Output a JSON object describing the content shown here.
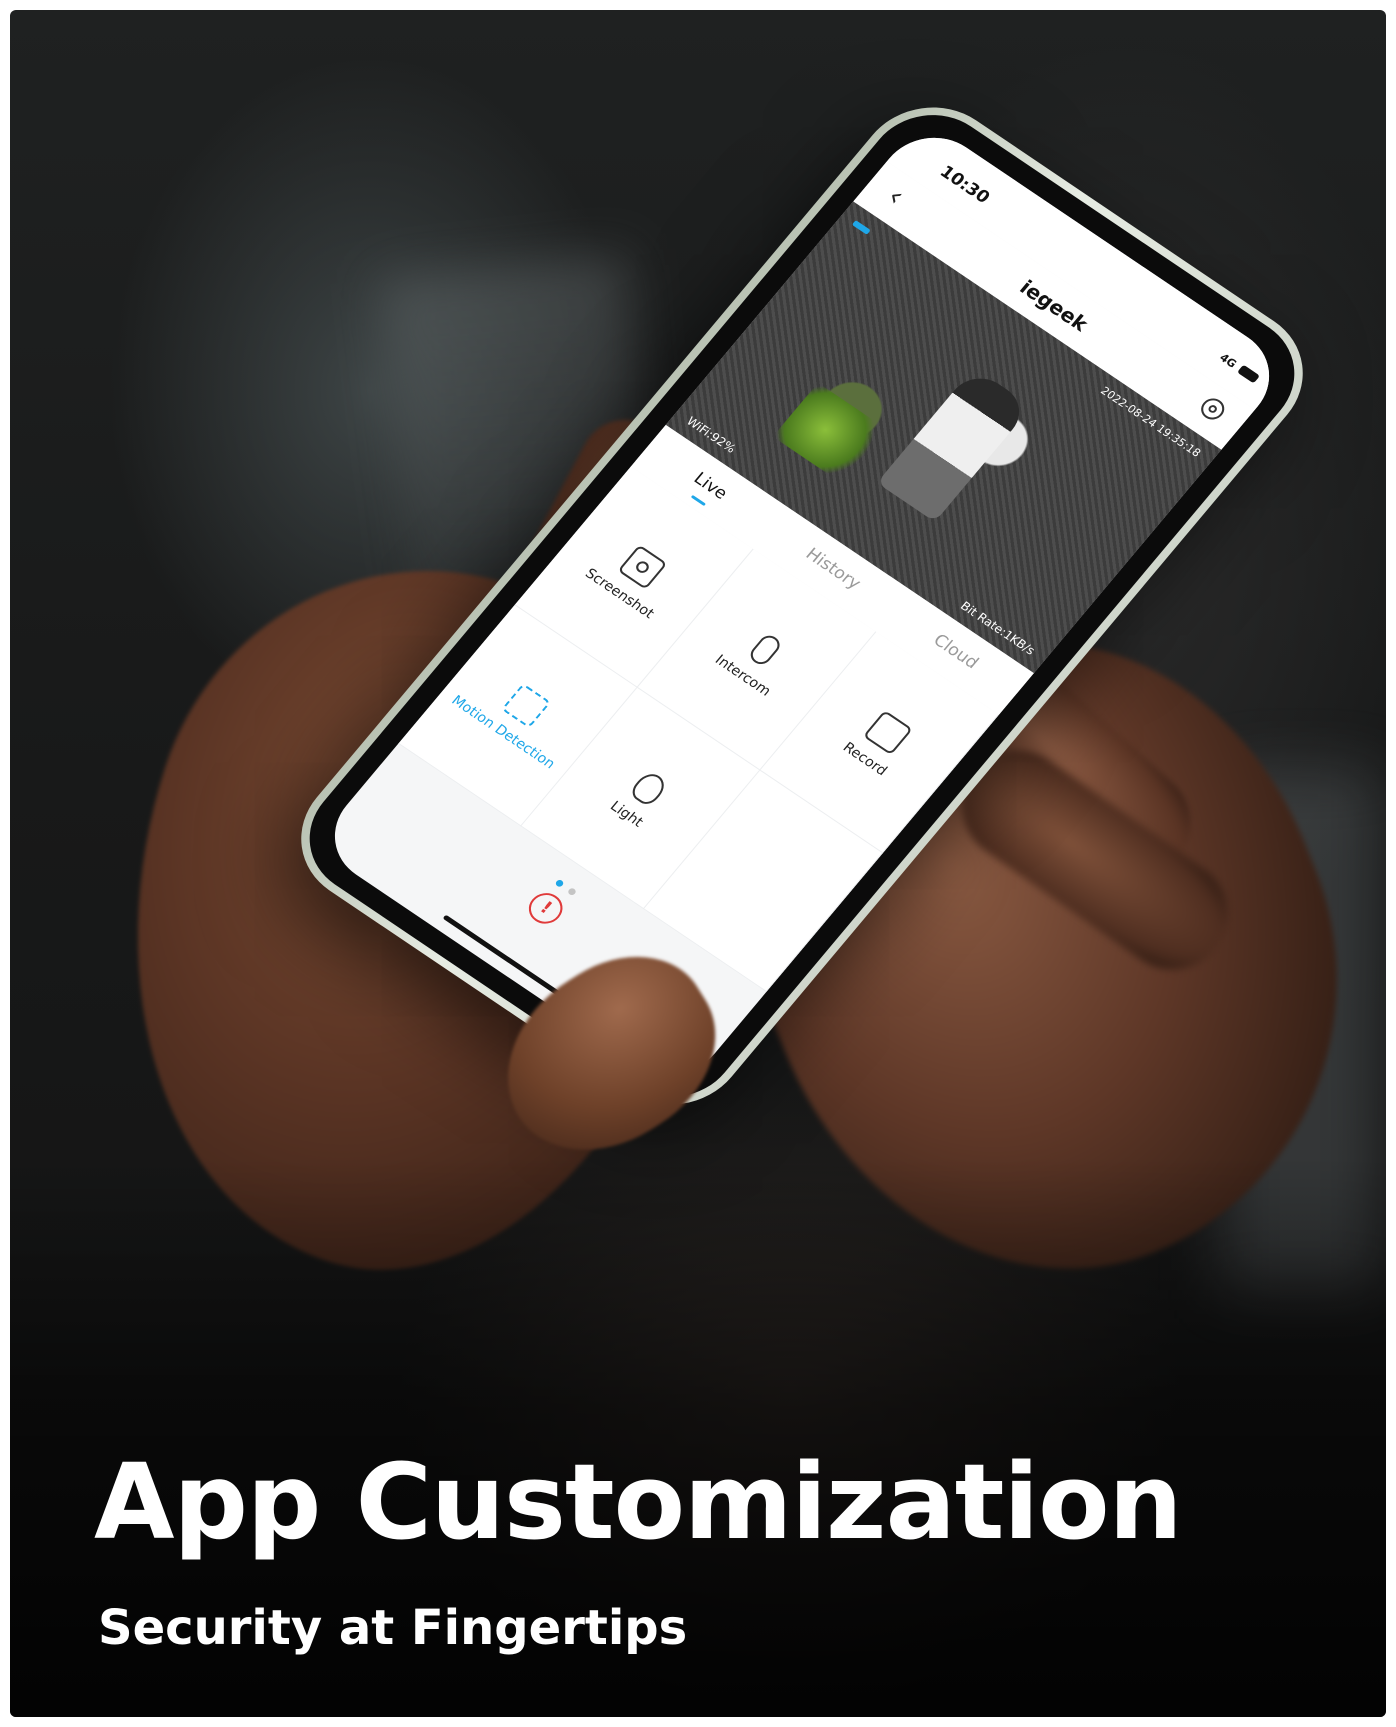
{
  "phone": {
    "status_time": "10:30",
    "status_network": "4G",
    "app_title": "iegeek",
    "back_glyph": "‹",
    "video": {
      "timestamp": "2022-08-24 19:35:18",
      "bit_rate": "Bit Rate:1KB/s",
      "wifi": "WiFi:92%"
    },
    "tabs": [
      {
        "label": "Live",
        "active": true
      },
      {
        "label": "History",
        "active": false
      },
      {
        "label": "Cloud",
        "active": false
      }
    ],
    "controls": [
      {
        "label": "Screenshot",
        "icon": "screenshot-icon"
      },
      {
        "label": "Intercom",
        "icon": "microphone-icon"
      },
      {
        "label": "Record",
        "icon": "record-icon"
      },
      {
        "label": "Motion Detection",
        "icon": "motion-detection-icon"
      },
      {
        "label": "Light",
        "icon": "light-bulb-icon"
      },
      {
        "label": "",
        "icon": ""
      }
    ],
    "alert_glyph": "!",
    "accent_color": "#1fa7e8",
    "alert_color": "#e03a3a"
  },
  "banner": {
    "headline": "App Customization",
    "subline": "Security at Fingertips"
  }
}
